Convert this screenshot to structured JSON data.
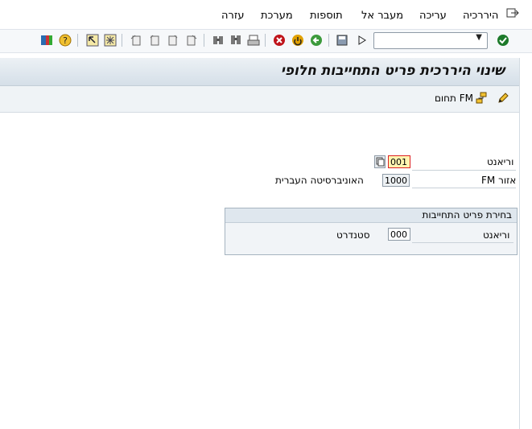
{
  "menu": {
    "items": [
      "היררכיה",
      "עריכה",
      "מעבר אל",
      "תוספות",
      "מערכת",
      "עזרה"
    ]
  },
  "title": "שינוי היררכית פריט התחייבות חלופי",
  "app_toolbar": {
    "fm_area_button": "תחום FM"
  },
  "fields": {
    "variant": {
      "label": "וריאנט",
      "value": "001"
    },
    "fm_area": {
      "label": "אזור FM",
      "value": "1000",
      "description": "האוניברסיטה העברית"
    }
  },
  "group": {
    "title": "בחירת פריט התחייבות",
    "variant": {
      "label": "וריאנט",
      "value": "000",
      "description": "סטנדרט"
    }
  },
  "icons": [
    "exit-icon",
    "check-icon",
    "enter-icon",
    "save-icon",
    "back-icon",
    "exit-red-icon",
    "cancel-icon",
    "print-icon",
    "find-icon",
    "find-next-icon",
    "first-page-icon",
    "previous-page-icon",
    "next-page-icon",
    "last-page-icon",
    "new-session-icon",
    "shortcut-icon",
    "help-icon",
    "layout-icon"
  ]
}
